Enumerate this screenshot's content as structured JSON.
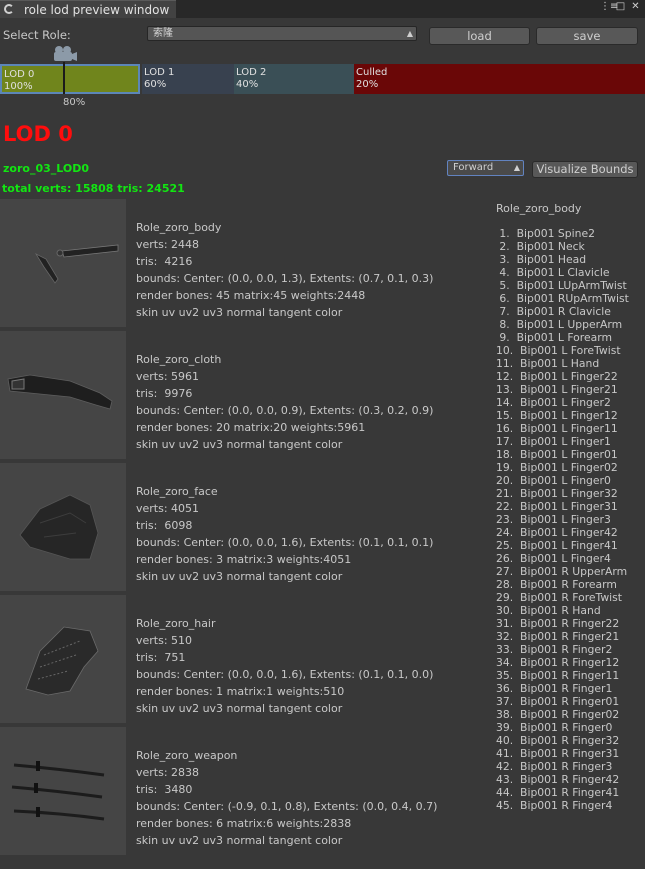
{
  "window": {
    "tab_title": "role lod preview window",
    "icons": [
      "refresh-icon",
      "menu-icon",
      "maximize-icon",
      "close-icon"
    ]
  },
  "toolbar": {
    "select_role_label": "Select Role:",
    "role_value": "索隆",
    "load_label": "load",
    "save_label": "save"
  },
  "lod_bar": {
    "marker_percent": "80%",
    "segments": [
      {
        "name": "LOD 0",
        "percent": "100%",
        "color": "#70851c"
      },
      {
        "name": "LOD 1",
        "percent": "60%",
        "color": "#38414f"
      },
      {
        "name": "LOD 2",
        "percent": "40%",
        "color": "#3a4f56"
      },
      {
        "name": "Culled",
        "percent": "20%",
        "color": "#6a0707"
      }
    ]
  },
  "lod_title": "LOD 0",
  "model_name": "zoro_03_LOD0",
  "totals": "total verts: 15808 tris: 24521",
  "view_mode": {
    "selected": "Forward"
  },
  "visualize_bounds_label": "Visualize Bounds",
  "meshes": [
    {
      "name": "Role_zoro_body",
      "verts": "verts: 2448",
      "tris": "tris:  4216",
      "bounds": "bounds: Center: (0.0, 0.0, 1.3), Extents: (0.7, 0.1, 0.3)",
      "render": "render bones: 45 matrix:45 weights:2448",
      "channels": "skin uv uv2 uv3 normal tangent color"
    },
    {
      "name": "Role_zoro_cloth",
      "verts": "verts: 5961",
      "tris": "tris:  9976",
      "bounds": "bounds: Center: (0.0, 0.0, 0.9), Extents: (0.3, 0.2, 0.9)",
      "render": "render bones: 20 matrix:20 weights:5961",
      "channels": "skin uv uv2 uv3 normal tangent color"
    },
    {
      "name": "Role_zoro_face",
      "verts": "verts: 4051",
      "tris": "tris:  6098",
      "bounds": "bounds: Center: (0.0, 0.0, 1.6), Extents: (0.1, 0.1, 0.1)",
      "render": "render bones: 3 matrix:3 weights:4051",
      "channels": "skin uv uv2 uv3 normal tangent color"
    },
    {
      "name": "Role_zoro_hair",
      "verts": "verts: 510",
      "tris": "tris:  751",
      "bounds": "bounds: Center: (0.0, 0.0, 1.6), Extents: (0.1, 0.1, 0.0)",
      "render": "render bones: 1 matrix:1 weights:510",
      "channels": "skin uv uv2 uv3 normal tangent color"
    },
    {
      "name": "Role_zoro_weapon",
      "verts": "verts: 2838",
      "tris": "tris:  3480",
      "bounds": "bounds: Center: (-0.9, 0.1, 0.8), Extents: (0.0, 0.4, 0.7)",
      "render": "render bones: 6 matrix:6 weights:2838",
      "channels": "skin uv uv2 uv3 normal tangent color"
    }
  ],
  "bone_list": {
    "title": "Role_zoro_body",
    "items": [
      " 1.  Bip001 Spine2",
      " 2.  Bip001 Neck",
      " 3.  Bip001 Head",
      " 4.  Bip001 L Clavicle",
      " 5.  Bip001 LUpArmTwist",
      " 6.  Bip001 RUpArmTwist",
      " 7.  Bip001 R Clavicle",
      " 8.  Bip001 L UpperArm",
      " 9.  Bip001 L Forearm",
      "10.  Bip001 L ForeTwist",
      "11.  Bip001 L Hand",
      "12.  Bip001 L Finger22",
      "13.  Bip001 L Finger21",
      "14.  Bip001 L Finger2",
      "15.  Bip001 L Finger12",
      "16.  Bip001 L Finger11",
      "17.  Bip001 L Finger1",
      "18.  Bip001 L Finger01",
      "19.  Bip001 L Finger02",
      "20.  Bip001 L Finger0",
      "21.  Bip001 L Finger32",
      "22.  Bip001 L Finger31",
      "23.  Bip001 L Finger3",
      "24.  Bip001 L Finger42",
      "25.  Bip001 L Finger41",
      "26.  Bip001 L Finger4",
      "27.  Bip001 R UpperArm",
      "28.  Bip001 R Forearm",
      "29.  Bip001 R ForeTwist",
      "30.  Bip001 R Hand",
      "31.  Bip001 R Finger22",
      "32.  Bip001 R Finger21",
      "33.  Bip001 R Finger2",
      "34.  Bip001 R Finger12",
      "35.  Bip001 R Finger11",
      "36.  Bip001 R Finger1",
      "37.  Bip001 R Finger01",
      "38.  Bip001 R Finger02",
      "39.  Bip001 R Finger0",
      "40.  Bip001 R Finger32",
      "41.  Bip001 R Finger31",
      "42.  Bip001 R Finger3",
      "43.  Bip001 R Finger42",
      "44.  Bip001 R Finger41",
      "45.  Bip001 R Finger4"
    ]
  }
}
